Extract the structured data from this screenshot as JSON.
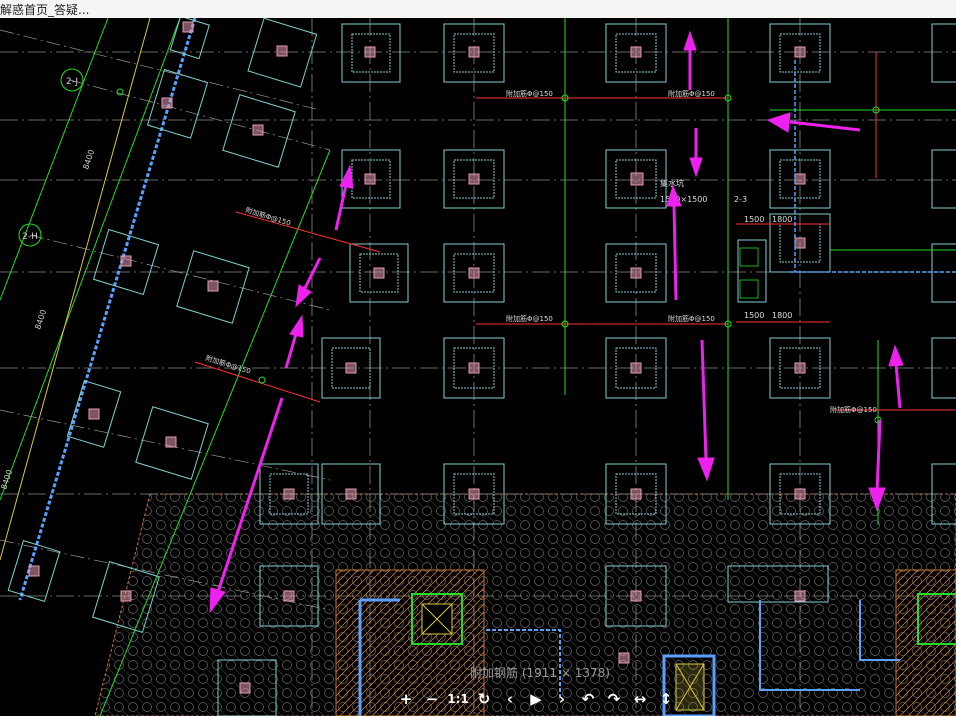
{
  "window": {
    "title": "解惑首页_答疑..."
  },
  "viewer": {
    "caption": "附加钢筋 (1911 × 1378)",
    "toolbar": [
      {
        "name": "zoom-in-button",
        "glyph": "+"
      },
      {
        "name": "zoom-out-button",
        "glyph": "−"
      },
      {
        "name": "actual-size-button",
        "glyph": "1:1"
      },
      {
        "name": "refresh-button",
        "glyph": "↻"
      },
      {
        "name": "previous-button",
        "glyph": "‹"
      },
      {
        "name": "play-button",
        "glyph": "▶"
      },
      {
        "name": "next-button",
        "glyph": "›"
      },
      {
        "name": "rotate-left-button",
        "glyph": "↶"
      },
      {
        "name": "rotate-right-button",
        "glyph": "↷"
      },
      {
        "name": "flip-horizontal-button",
        "glyph": "↔"
      },
      {
        "name": "flip-vertical-button",
        "glyph": "↕"
      }
    ]
  },
  "drawing": {
    "axis_labels": [
      "2-J",
      "2-H"
    ],
    "dimension_labels": [
      "8400",
      "8400",
      "8400",
      "1500",
      "1800",
      "1500",
      "1800"
    ],
    "annotations": [
      "集水坑",
      "1500×1500",
      "2-3"
    ],
    "rebar_labels": [
      "附加筋Φ@150",
      "附加筋Φ@150",
      "附加筋Φ@150",
      "附加筋Φ@150",
      "附加筋Φ@150",
      "附加筋Φ@150",
      "附加筋Φ@150"
    ],
    "colors": {
      "background": "#000000",
      "grid": "#8a8a8a",
      "axis": "#22dd22",
      "column": "#7fd0d0",
      "column_core": "#e39bb0",
      "rebar": "#ff3030",
      "arrow": "#ee22ee",
      "hatch": "#c8762e",
      "wall": "#5aa0ff"
    }
  }
}
